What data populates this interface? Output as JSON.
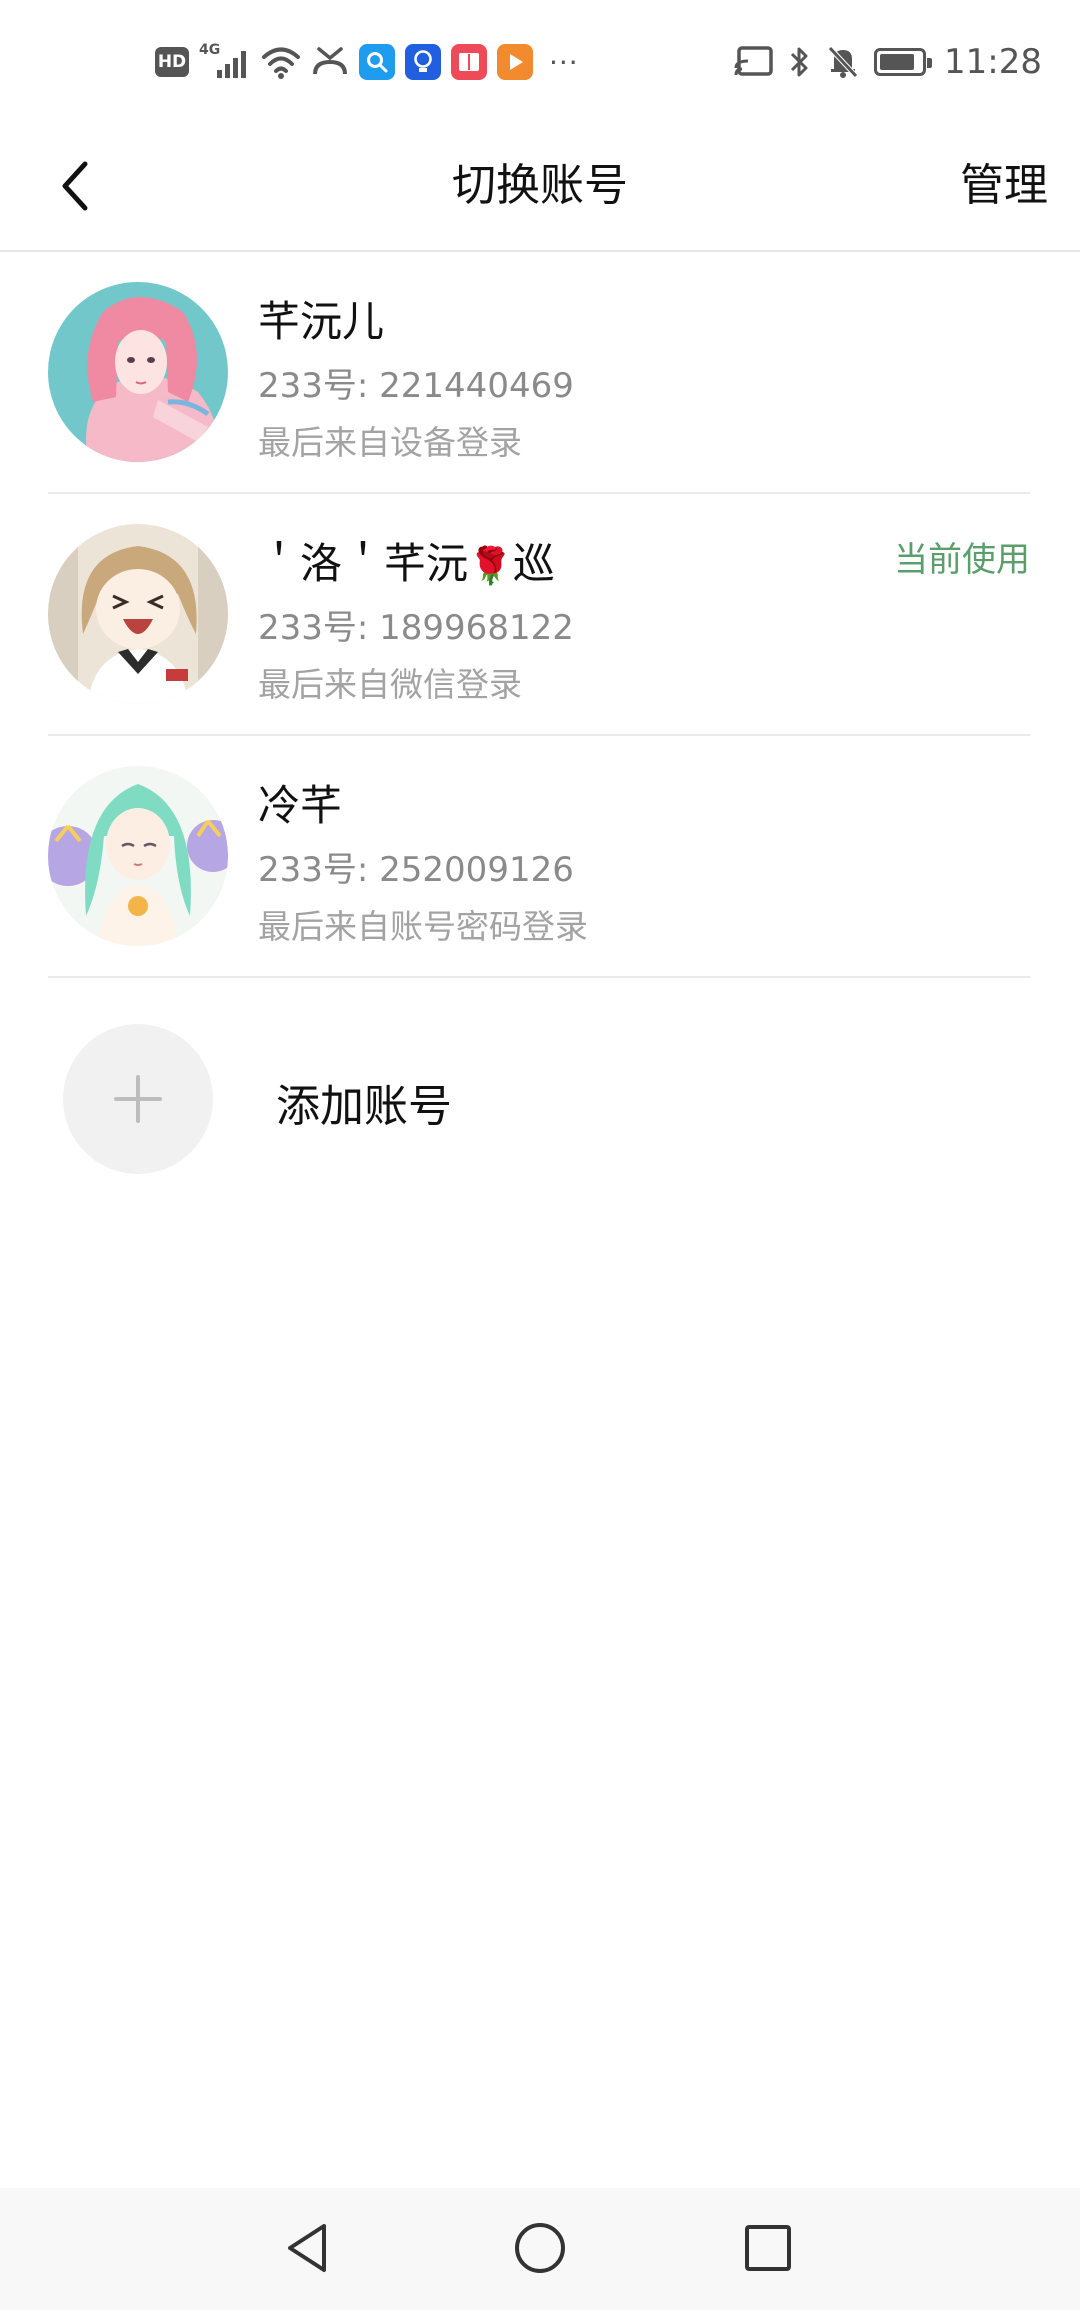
{
  "status_bar": {
    "hd": "HD",
    "network": "4G",
    "more": "···",
    "time": "11:28",
    "battery_level": 0.85,
    "icons": [
      "hd-icon",
      "signal-4g-icon",
      "wifi-icon",
      "missed-call-icon",
      "search-app-icon",
      "bulb-app-icon",
      "book-app-icon",
      "video-app-icon",
      "cast-icon",
      "bluetooth-icon",
      "mute-bell-icon",
      "battery-icon"
    ]
  },
  "header": {
    "back_icon": "chevron-left-icon",
    "title": "切换账号",
    "manage_label": "管理"
  },
  "accounts": [
    {
      "name": "芊沅儿",
      "id_text": "233号: 221440469",
      "login_text": "最后来自设备登录",
      "current": false,
      "avatar_colors": [
        "#6fc5c9",
        "#f4a6b8"
      ]
    },
    {
      "name_prefix": "＇洛＇芊沅",
      "name_emoji": "🌹",
      "name_suffix": "巡",
      "id_text": "233号: 189968122",
      "login_text": "最后来自微信登录",
      "current": true,
      "current_label": "当前使用",
      "accent": "#5a9e6b",
      "avatar_colors": [
        "#d9c6a8",
        "#f3ede3"
      ]
    },
    {
      "name": "冷芊",
      "id_text": "233号: 252009126",
      "login_text": "最后来自账号密码登录",
      "current": false,
      "avatar_colors": [
        "#8fd9c0",
        "#b8a5e0"
      ]
    }
  ],
  "add_account": {
    "icon": "plus-icon",
    "label": "添加账号"
  },
  "nav": {
    "back_icon": "triangle-back-icon",
    "home_icon": "circle-home-icon",
    "recents_icon": "square-recents-icon"
  }
}
